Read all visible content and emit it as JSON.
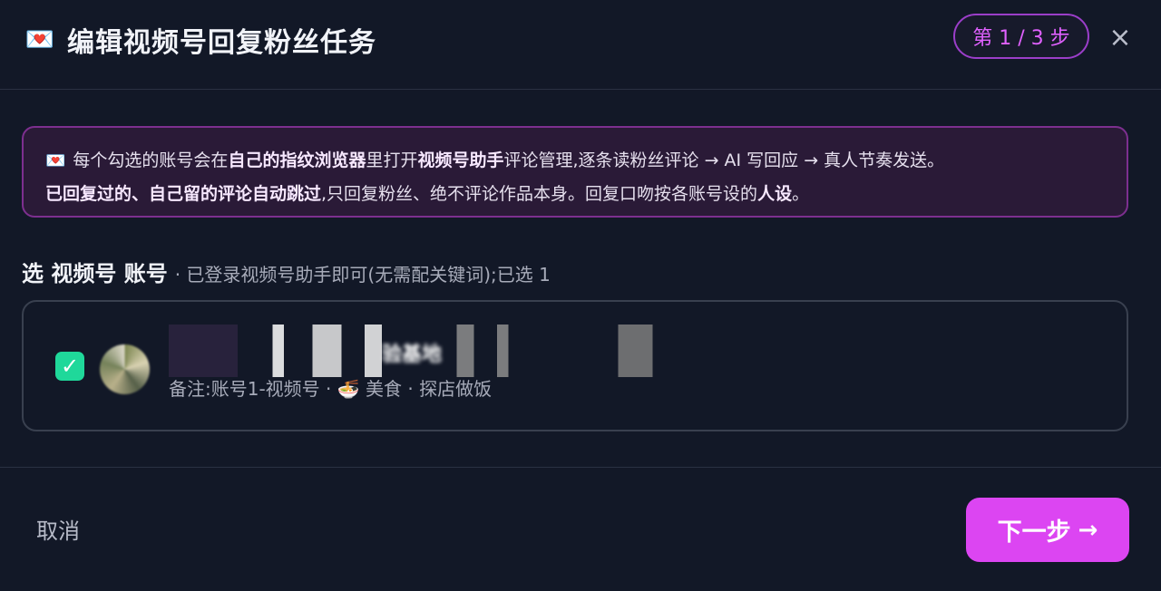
{
  "modal": {
    "title_icon": "💌",
    "title": "编辑视频号回复粉丝任务",
    "step_label": "第 1 / 3 步",
    "close_icon": "×"
  },
  "notice": {
    "icon": "💌",
    "text1": "每个勾选的账号会在",
    "bold1": "自己的指纹浏览器",
    "text2": "里打开",
    "bold2": "视频号助手",
    "text3": "评论管理,逐条读粉丝评论 → AI 写回应 → 真人节奏发送。",
    "bold3": "已回复过的、自己留的评论自动跳过",
    "text4": ",只回复粉丝、绝不评论作品本身。回复口吻按各账号设的",
    "bold4": "人设",
    "text5": "。"
  },
  "accounts_section": {
    "title": "选 视频号 账号",
    "subtitle": "· 已登录视频号助手即可(无需配关键词);已选 1",
    "selected_count": 1
  },
  "account": {
    "checked": true,
    "name": "验基地",
    "meta": "备注:账号1-视频号 · 🍜 美食 · 探店做饭"
  },
  "footer": {
    "cancel_label": "取消",
    "next_label": "下一步",
    "next_icon": "→"
  },
  "colors": {
    "background": "#121827",
    "accent": "#dc45f2",
    "check": "#1fd89a",
    "notice_border": "#7d2f8f"
  }
}
